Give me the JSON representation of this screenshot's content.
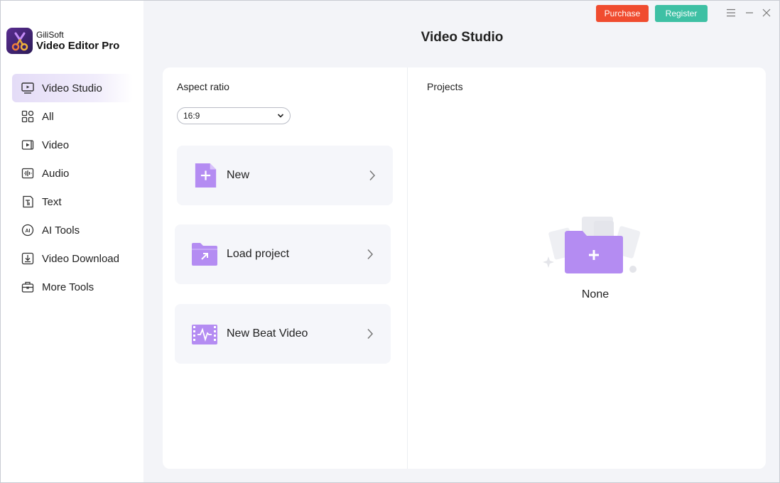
{
  "app": {
    "brand_name": "GiliSoft",
    "product_name": "Video Editor Pro"
  },
  "topbar": {
    "purchase_label": "Purchase",
    "register_label": "Register",
    "purchase_color": "#f04c2f",
    "register_color": "#3ec0a4"
  },
  "sidebar": {
    "items": [
      {
        "label": "Video Studio",
        "icon": "video-studio-icon",
        "active": true
      },
      {
        "label": "All",
        "icon": "grid-icon"
      },
      {
        "label": "Video",
        "icon": "video-icon"
      },
      {
        "label": "Audio",
        "icon": "audio-icon"
      },
      {
        "label": "Text",
        "icon": "text-icon"
      },
      {
        "label": "AI Tools",
        "icon": "ai-icon"
      },
      {
        "label": "Video Download",
        "icon": "download-icon"
      },
      {
        "label": "More Tools",
        "icon": "toolbox-icon"
      }
    ]
  },
  "main": {
    "title": "Video Studio",
    "aspect_ratio_label": "Aspect ratio",
    "aspect_ratio_value": "16:9",
    "actions": [
      {
        "label": "New",
        "icon": "new-file-icon"
      },
      {
        "label": "Load project",
        "icon": "folder-open-icon"
      },
      {
        "label": "New Beat Video",
        "icon": "beat-video-icon"
      }
    ],
    "projects_label": "Projects",
    "projects_empty": "None"
  },
  "colors": {
    "accent": "#a47ff0",
    "active_nav": "#e4dcf7"
  }
}
